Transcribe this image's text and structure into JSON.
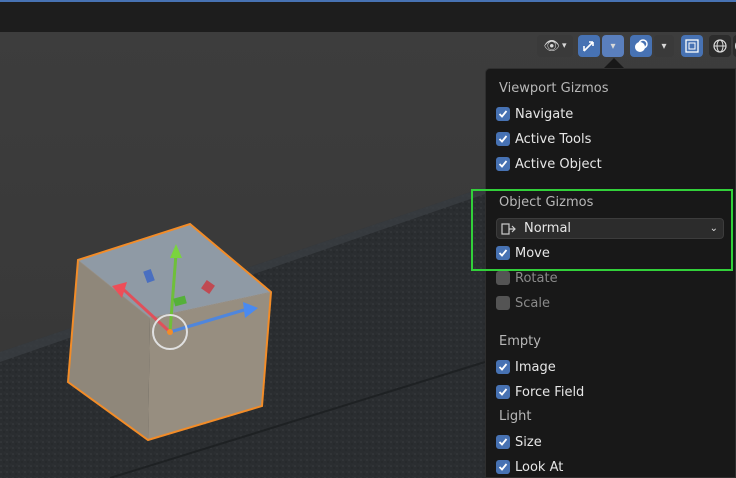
{
  "header": {
    "icons": [
      "visibility-eye-icon",
      "chevron-down-icon",
      "gizmo-icon",
      "chevron-down-icon",
      "overlays-icon",
      "chevron-down-icon",
      "xray-icon",
      "wireframe-shading-icon"
    ]
  },
  "popover": {
    "viewport_title": "Viewport Gizmos",
    "viewport_items": [
      {
        "label": "Navigate",
        "checked": true
      },
      {
        "label": "Active Tools",
        "checked": true
      },
      {
        "label": "Active Object",
        "checked": true
      }
    ],
    "object_title": "Object Gizmos",
    "orientation_select": "Normal",
    "object_items": [
      {
        "label": "Move",
        "checked": true
      },
      {
        "label": "Rotate",
        "checked": false
      },
      {
        "label": "Scale",
        "checked": false
      }
    ],
    "empty_title": "Empty",
    "empty_items": [
      {
        "label": "Image",
        "checked": true
      },
      {
        "label": "Force Field",
        "checked": true
      }
    ],
    "light_title": "Light",
    "light_items": [
      {
        "label": "Size",
        "checked": true
      },
      {
        "label": "Look At",
        "checked": true
      }
    ]
  },
  "colors": {
    "accent": "#4772b3",
    "highlight_box": "#32d03a",
    "selection_outline": "#f28c28"
  }
}
